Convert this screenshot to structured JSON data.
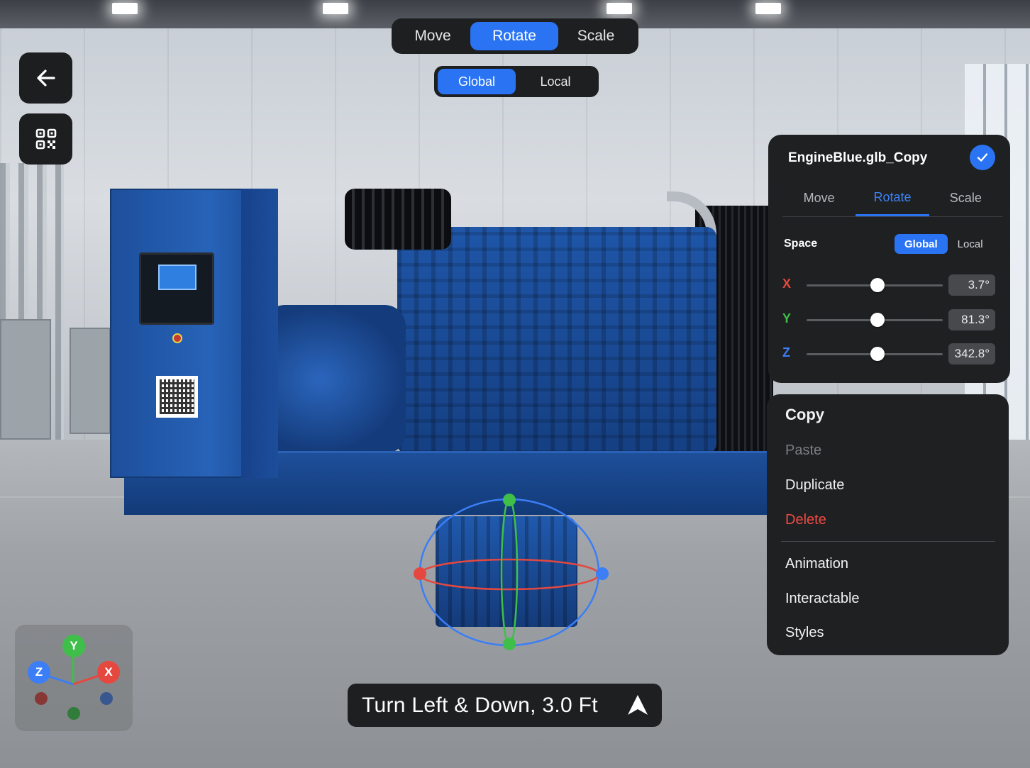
{
  "toolbar": {
    "modes": [
      "Move",
      "Rotate",
      "Scale"
    ],
    "active_mode": "Rotate",
    "spaces": [
      "Global",
      "Local"
    ],
    "active_space": "Global"
  },
  "sidebar": {
    "back_icon": "arrow-left-icon",
    "qr_icon": "qr-code-icon"
  },
  "inspector": {
    "title": "EngineBlue.glb_Copy",
    "confirm_icon": "check-icon",
    "tabs": [
      "Move",
      "Rotate",
      "Scale"
    ],
    "active_tab": "Rotate",
    "space_label": "Space",
    "space_options": [
      "Global",
      "Local"
    ],
    "active_space": "Global",
    "axes": [
      {
        "label": "X",
        "value": "3.7°",
        "slider_fraction": 0.52,
        "color": "#e5483f"
      },
      {
        "label": "Y",
        "value": "81.3°",
        "slider_fraction": 0.52,
        "color": "#3fbf4a"
      },
      {
        "label": "Z",
        "value": "342.8°",
        "slider_fraction": 0.52,
        "color": "#3b7ef5"
      }
    ]
  },
  "context_menu": {
    "items": [
      {
        "label": "Copy",
        "state": "title"
      },
      {
        "label": "Paste",
        "state": "disabled"
      },
      {
        "label": "Duplicate",
        "state": "normal"
      },
      {
        "label": "Delete",
        "state": "danger"
      },
      {
        "label": "Animation",
        "state": "normal"
      },
      {
        "label": "Interactable",
        "state": "normal"
      },
      {
        "label": "Styles",
        "state": "normal"
      }
    ]
  },
  "axis_widget": {
    "y_label": "Y",
    "z_label": "Z",
    "x_label": "X"
  },
  "hint": {
    "text": "Turn Left & Down, 3.0 Ft",
    "icon": "navigation-arrow-icon"
  },
  "colors": {
    "accent": "#2a74f4",
    "x_axis": "#e5483f",
    "y_axis": "#3fbf4a",
    "z_axis": "#3b7ef5",
    "panel_bg": "#1f2022"
  }
}
